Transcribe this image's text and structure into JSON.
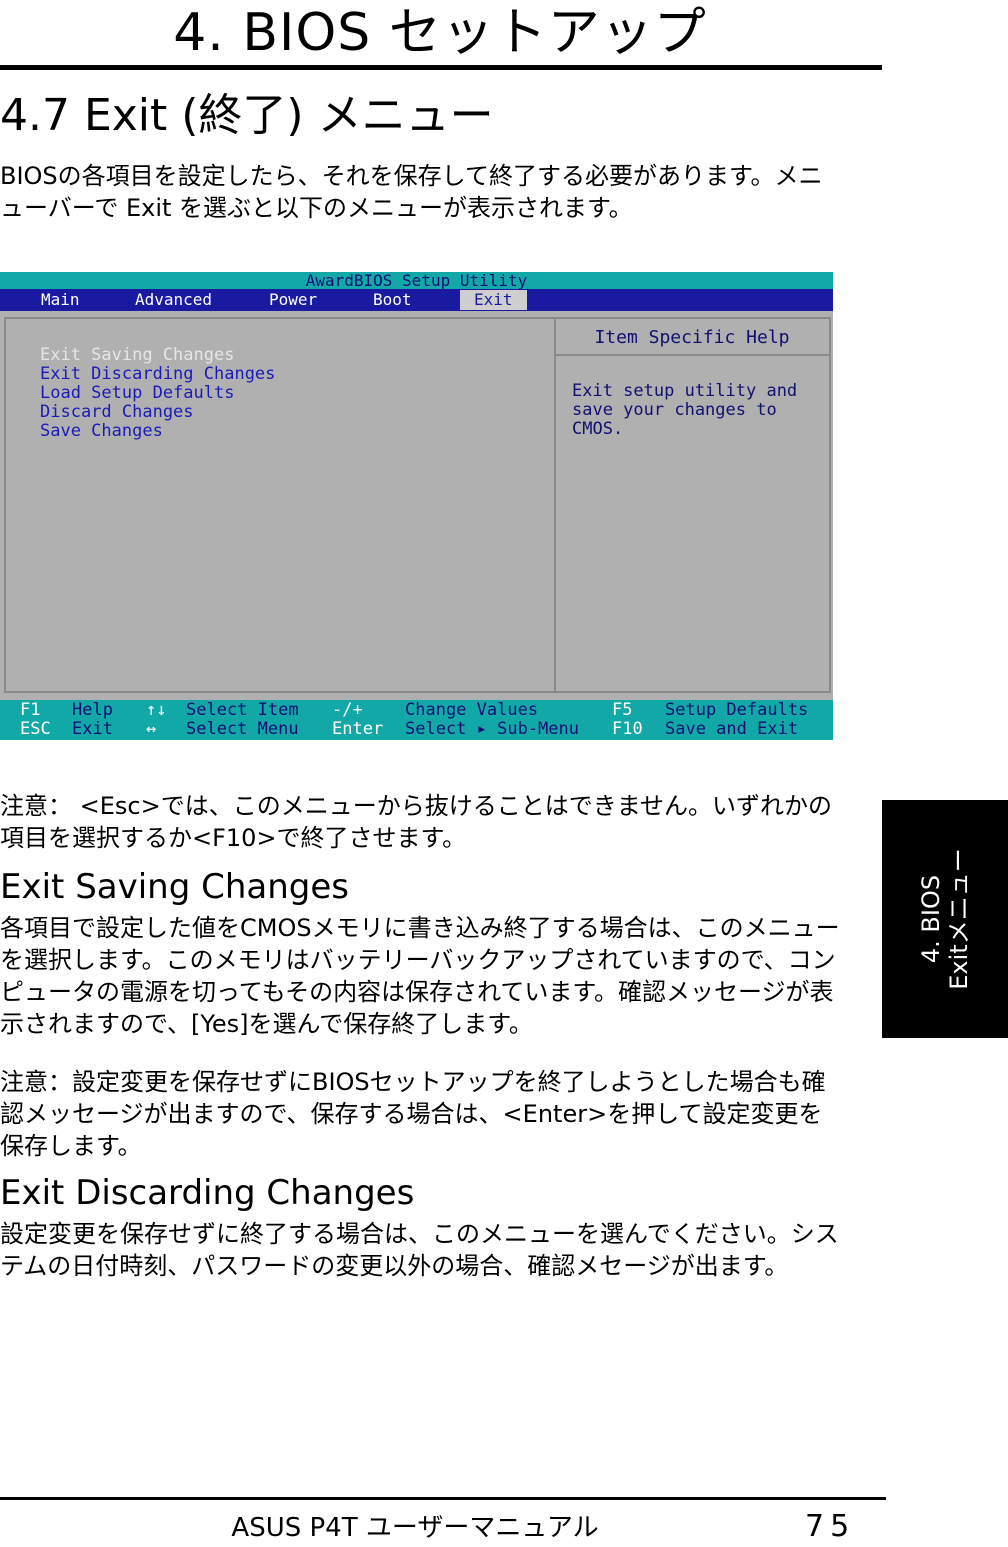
{
  "chapter": {
    "title": "4. BIOS セットアップ"
  },
  "section": {
    "title": "4.7 Exit (終了) メニュー"
  },
  "intro": "BIOSの各項目を設定したら、それを保存して終了する必要があります。メニューバーで Exit を選ぶと以下のメニューが表示されます。",
  "bios": {
    "title": "AwardBIOS Setup Utility",
    "menus": [
      "Main",
      "Advanced",
      "Power",
      "Boot",
      "Exit"
    ],
    "active_menu": "Exit",
    "exit_items": [
      "Exit Saving Changes",
      "Exit Discarding Changes",
      "Load Setup Defaults",
      "Discard Changes",
      "Save Changes"
    ],
    "selected_item": "Exit Saving Changes",
    "help_title": "Item Specific Help",
    "help_text": "Exit setup utility and save your changes to CMOS.",
    "footer": {
      "keys": [
        {
          "key": "F1",
          "desc": "Help"
        },
        {
          "key": "ESC",
          "desc": "Exit"
        },
        {
          "key": "↑↓",
          "desc": "Select Item"
        },
        {
          "key": "↔",
          "desc": "Select Menu"
        },
        {
          "key": "-/+",
          "desc": "Change Values"
        },
        {
          "key": "Enter",
          "desc": "Select ▸ Sub-Menu"
        },
        {
          "key": "F5",
          "desc": "Setup Defaults"
        },
        {
          "key": "F10",
          "desc": "Save and Exit"
        }
      ]
    },
    "colors": {
      "menubar": "#1a1aa0",
      "statusbar": "#13a8a8",
      "panel": "#b0b0b0"
    }
  },
  "note1": "注意： <Esc>では、このメニューから抜けることはできません。いずれかの項目を選択するか<F10>で終了させます。",
  "exit_saving": {
    "heading": "Exit Saving Changes",
    "body": "各項目で設定した値をCMOSメモリに書き込み終了する場合は、このメニューを選択します。このメモリはバッテリーバックアップされていますので、コンピュータの電源を切ってもその内容は保存されています。確認メッセージが表示されますので、[Yes]を選んで保存終了します。",
    "note": "注意：設定変更を保存せずにBIOSセットアップを終了しようとした場合も確認メッセージが出ますので、保存する場合は、<Enter>を押して設定変更を保存します。"
  },
  "exit_discarding": {
    "heading": "Exit Discarding Changes",
    "body": "設定変更を保存せずに終了する場合は、このメニューを選んでください。システムの日付時刻、パスワードの変更以外の場合、確認メセージが出ます。"
  },
  "side_tab": {
    "line1": "4. BIOS",
    "line2": "Exitメニュー"
  },
  "footer": {
    "title": "ASUS P4T ユーザーマニュアル",
    "page": "75"
  }
}
